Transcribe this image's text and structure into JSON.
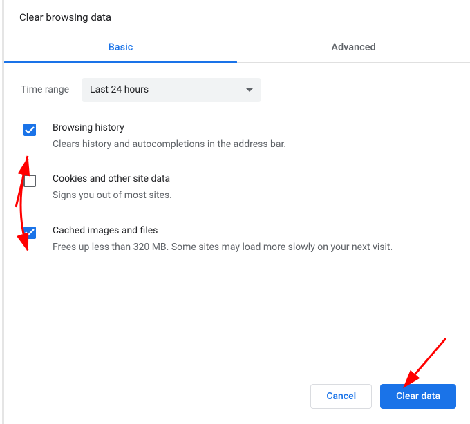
{
  "colors": {
    "accent": "#1a73e8",
    "text_secondary": "#5f6368",
    "annotation_arrow": "#ff0000"
  },
  "dialog": {
    "title": "Clear browsing data",
    "tabs": [
      {
        "label": "Basic",
        "active": true
      },
      {
        "label": "Advanced",
        "active": false
      }
    ],
    "time_range": {
      "label": "Time range",
      "selected": "Last 24 hours"
    },
    "options": [
      {
        "checked": true,
        "title": "Browsing history",
        "description": "Clears history and autocompletions in the address bar."
      },
      {
        "checked": false,
        "title": "Cookies and other site data",
        "description": "Signs you out of most sites."
      },
      {
        "checked": true,
        "title": "Cached images and files",
        "description": "Frees up less than 320 MB. Some sites may load more slowly on your next visit."
      }
    ],
    "buttons": {
      "cancel": "Cancel",
      "clear": "Clear data"
    }
  }
}
